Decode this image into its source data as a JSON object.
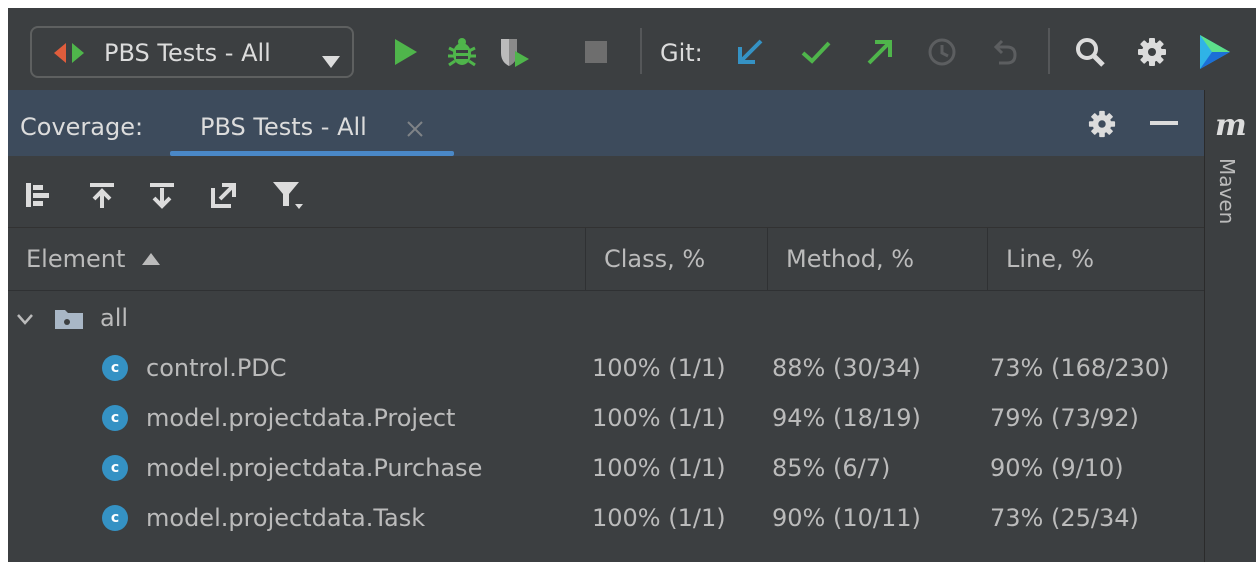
{
  "toolbar": {
    "run_config": "PBS Tests - All",
    "git_label": "Git:",
    "icons": [
      "run-icon",
      "debug-icon",
      "coverage-run-icon",
      "stop-icon",
      "git-update-icon",
      "git-commit-icon",
      "git-push-icon",
      "git-history-icon",
      "git-rollback-icon",
      "search-icon",
      "settings-icon",
      "plugin-logo-icon"
    ]
  },
  "tool_window": {
    "title": "Coverage:",
    "tab_label": "PBS Tests - All",
    "icons": [
      "settings-icon",
      "minimize-icon"
    ]
  },
  "sub_toolbar": {
    "icons": [
      "flatten-packages-icon",
      "navigate-up-icon",
      "navigate-down-icon",
      "export-icon",
      "filter-icon"
    ]
  },
  "table": {
    "headers": {
      "element": "Element",
      "class": "Class, %",
      "method": "Method, %",
      "line": "Line, %"
    },
    "root": {
      "name": "all"
    },
    "rows": [
      {
        "name": "control.PDC",
        "class": "100% (1/1)",
        "method": "88% (30/34)",
        "line": "73% (168/230)"
      },
      {
        "name": "model.projectdata.Project",
        "class": "100% (1/1)",
        "method": "94% (18/19)",
        "line": "79% (73/92)"
      },
      {
        "name": "model.projectdata.Purchase",
        "class": "100% (1/1)",
        "method": "85% (6/7)",
        "line": "90% (9/10)"
      },
      {
        "name": "model.projectdata.Task",
        "class": "100% (1/1)",
        "method": "90% (10/11)",
        "line": "73% (25/34)"
      }
    ],
    "class_icon_letter": "c"
  },
  "right_strip": {
    "logo_letter": "m",
    "label": "Maven"
  },
  "colors": {
    "background": "#3c3f41",
    "header_bg": "#3d4b5c",
    "accent": "#4a88c7",
    "run_green": "#4fb54b",
    "class_icon": "#3592c4",
    "git_update_blue": "#3592c4"
  }
}
